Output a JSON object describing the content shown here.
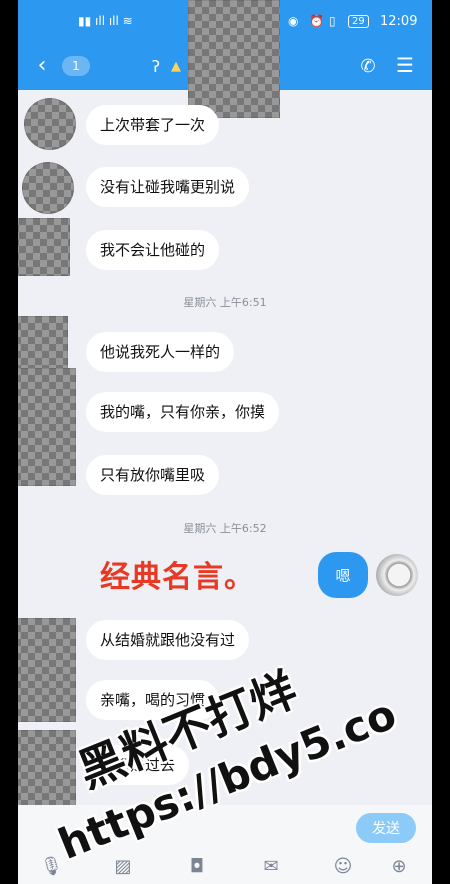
{
  "status_bar": {
    "time": "12:09",
    "battery": "29"
  },
  "header": {
    "unread_count": "1"
  },
  "messages": [
    {
      "text": "上次带套了一次"
    },
    {
      "text": "没有让碰我嘴更别说"
    },
    {
      "text": "我不会让他碰的"
    },
    {
      "text": "他说我死人一样的"
    },
    {
      "text": "我的嘴，只有你亲，你摸"
    },
    {
      "text": "只有放你嘴里吸"
    },
    {
      "text": "从结婚就跟他没有过"
    },
    {
      "text": "亲嘴，喝的习惯"
    },
    {
      "text": "那都是过去"
    }
  ],
  "timestamps": {
    "t1": "星期六 上午6:51",
    "t2": "星期六 上午6:52"
  },
  "overlay_caption": "经典名言。",
  "my_message": "嗯",
  "input": {
    "send_label": "发送"
  },
  "watermark": {
    "line1": "黑料不打烊",
    "line2": "https://bdy5.co"
  },
  "colors": {
    "header_blue": "#2c98f0",
    "caption_red": "#e63a24"
  }
}
